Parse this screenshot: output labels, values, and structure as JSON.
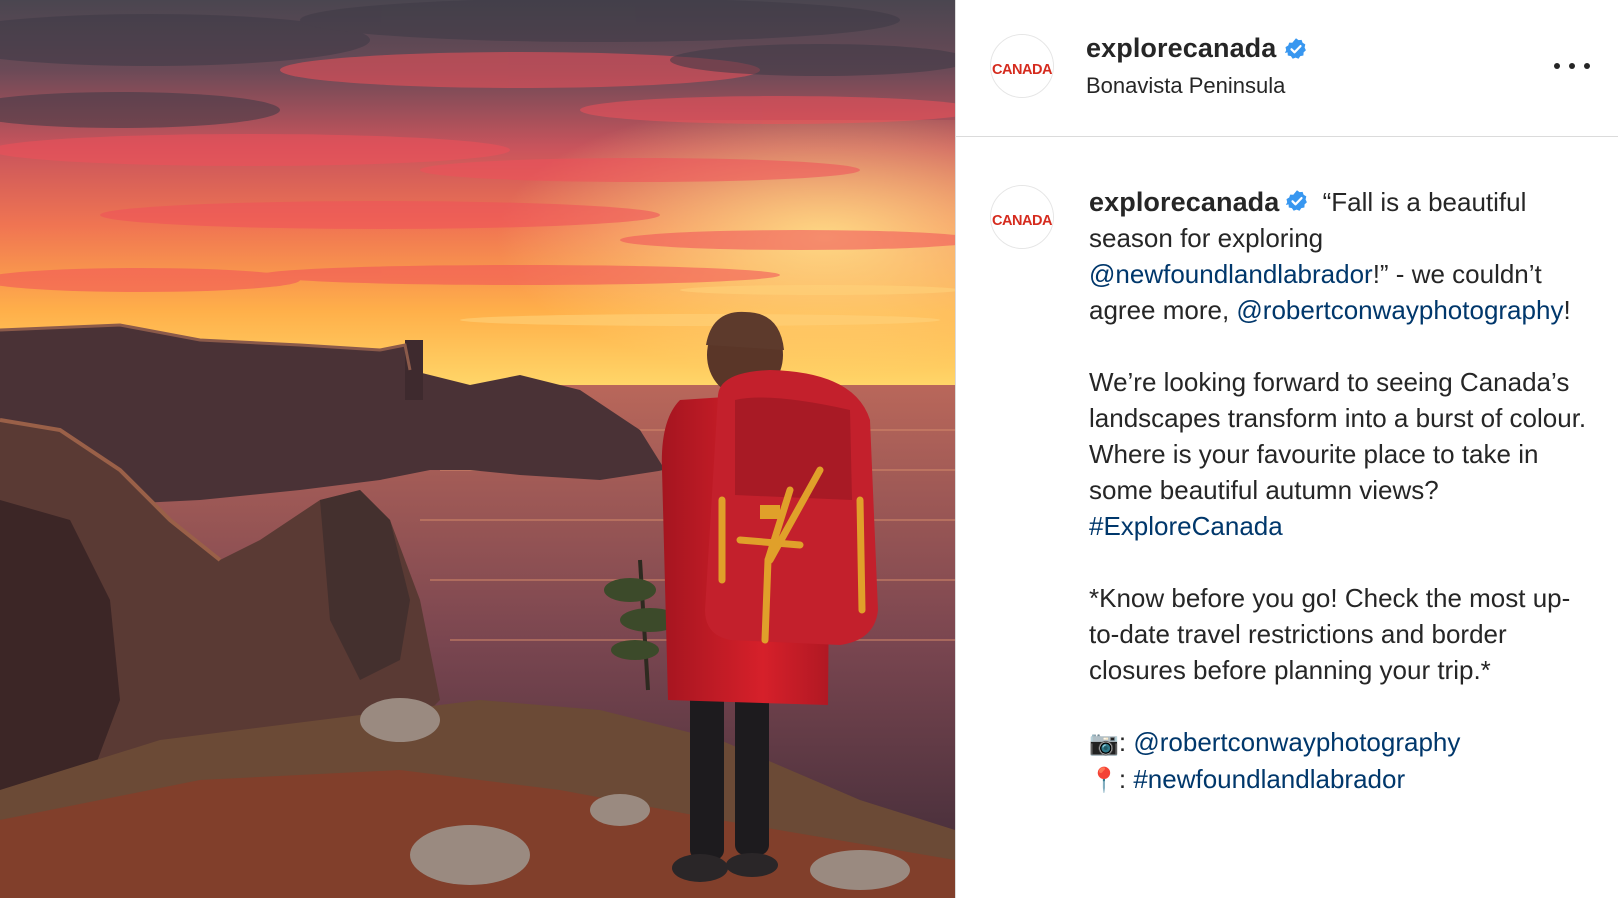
{
  "post": {
    "photo_alt": "Hiker with red backpack watching sunset over sea cliffs",
    "author": {
      "username": "explorecanada",
      "verified": true,
      "avatar_text": "CANADA",
      "location": "Bonavista Peninsula"
    },
    "more_label": "More options",
    "caption": {
      "line1_text": " “Fall is a beautiful season for exploring ",
      "mention1": "@newfoundlandlabrador",
      "line1_after": "!” - we couldn’t agree more, ",
      "mention2": "@robertconwayphotography",
      "line1_end": "!",
      "para2_text": "We’re looking forward to seeing Canada’s landscapes transform into a burst of colour. Where is your favourite place to take in some beautiful autumn views? ",
      "hashtag1": "#ExploreCanada",
      "para3_text": "*Know before you go! Check the most up-to-date travel restrictions and border closures before planning your trip.*",
      "camera_emoji": "📷",
      "camera_sep": ": ",
      "camera_mention": "@robertconwayphotography",
      "pin_emoji": "📍",
      "pin_sep": ": ",
      "pin_hashtag": "#newfoundlandlabrador"
    }
  },
  "colors": {
    "link": "#00376b",
    "verified": "#3897f0",
    "brand_red": "#d52b1e",
    "divider": "#dbdbdb"
  },
  "icons": {
    "verified": "verified-badge-icon",
    "more": "more-options-icon",
    "camera": "camera-emoji",
    "pin": "pin-emoji"
  }
}
